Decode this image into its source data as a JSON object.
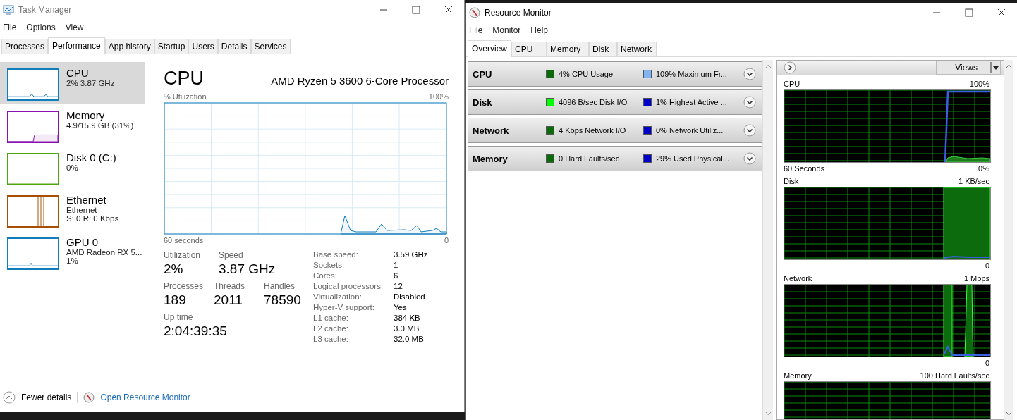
{
  "task_manager": {
    "title": "Task Manager",
    "menu": [
      "File",
      "Options",
      "View"
    ],
    "tabs": [
      {
        "label": "Processes",
        "selected": false
      },
      {
        "label": "Performance",
        "selected": true
      },
      {
        "label": "App history",
        "selected": false
      },
      {
        "label": "Startup",
        "selected": false
      },
      {
        "label": "Users",
        "selected": false
      },
      {
        "label": "Details",
        "selected": false
      },
      {
        "label": "Services",
        "selected": false
      }
    ],
    "sidebar": [
      {
        "name": "CPU",
        "lines": [
          "2% 3.87 GHz"
        ],
        "color": "#117dbb",
        "selected": true
      },
      {
        "name": "Memory",
        "lines": [
          "4.9/15.9 GB (31%)"
        ],
        "color": "#8b12ae",
        "selected": false
      },
      {
        "name": "Disk 0 (C:)",
        "lines": [
          "0%"
        ],
        "color": "#4da60c",
        "selected": false
      },
      {
        "name": "Ethernet",
        "lines": [
          "Ethernet",
          "S: 0 R: 0 Kbps"
        ],
        "color": "#a74f01",
        "selected": false
      },
      {
        "name": "GPU 0",
        "lines": [
          "AMD Radeon RX 5...",
          "1%"
        ],
        "color": "#117dbb",
        "selected": false
      }
    ],
    "detail": {
      "title": "CPU",
      "processor": "AMD Ryzen 5 3600 6-Core Processor",
      "chart_label": "% Utilization",
      "chart_max": "100%",
      "chart_span": "60 seconds",
      "chart_min": "0",
      "stat_rows": [
        {
          "items": [
            {
              "label": "Utilization",
              "value": "2%"
            },
            {
              "label": "Speed",
              "value": "3.87 GHz"
            }
          ]
        },
        {
          "items": [
            {
              "label": "Processes",
              "value": "189"
            },
            {
              "label": "Threads",
              "value": "2011"
            },
            {
              "label": "Handles",
              "value": "78590"
            }
          ]
        },
        {
          "items": [
            {
              "label": "Up time",
              "value": "2:04:39:35"
            }
          ]
        }
      ],
      "specs": [
        {
          "label": "Base speed:",
          "value": "3.59 GHz"
        },
        {
          "label": "Sockets:",
          "value": "1"
        },
        {
          "label": "Cores:",
          "value": "6"
        },
        {
          "label": "Logical processors:",
          "value": "12"
        },
        {
          "label": "Virtualization:",
          "value": "Disabled"
        },
        {
          "label": "Hyper-V support:",
          "value": "Yes"
        },
        {
          "label": "L1 cache:",
          "value": "384 KB"
        },
        {
          "label": "L2 cache:",
          "value": "3.0 MB"
        },
        {
          "label": "L3 cache:",
          "value": "32.0 MB"
        }
      ]
    },
    "footer": {
      "fewer_details": "Fewer details",
      "link": "Open Resource Monitor"
    }
  },
  "resource_monitor": {
    "title": "Resource Monitor",
    "menu": [
      "File",
      "Monitor",
      "Help"
    ],
    "tabs": [
      {
        "label": "Overview",
        "selected": true
      },
      {
        "label": "CPU",
        "selected": false
      },
      {
        "label": "Memory",
        "selected": false
      },
      {
        "label": "Disk",
        "selected": false
      },
      {
        "label": "Network",
        "selected": false
      }
    ],
    "sections": [
      {
        "name": "CPU",
        "metrics": [
          {
            "color": "#0b6b0b",
            "text": "4% CPU Usage"
          },
          {
            "color": "#7fb4f0",
            "text": "109% Maximum Fr..."
          }
        ]
      },
      {
        "name": "Disk",
        "metrics": [
          {
            "color": "#00ff00",
            "text": "4096 B/sec Disk I/O"
          },
          {
            "color": "#0000c8",
            "text": "1% Highest Active ..."
          }
        ]
      },
      {
        "name": "Network",
        "metrics": [
          {
            "color": "#0b6b0b",
            "text": "4 Kbps Network I/O"
          },
          {
            "color": "#0000c8",
            "text": "0% Network Utiliz..."
          }
        ]
      },
      {
        "name": "Memory",
        "metrics": [
          {
            "color": "#0b6b0b",
            "text": "0 Hard Faults/sec"
          },
          {
            "color": "#0000c8",
            "text": "29% Used Physical..."
          }
        ]
      }
    ],
    "views": "Views",
    "graphs": [
      {
        "title": "CPU",
        "max": "100%",
        "span": "60 Seconds",
        "min": "0%"
      },
      {
        "title": "Disk",
        "max": "1 KB/sec",
        "min": "0"
      },
      {
        "title": "Network",
        "max": "1 Mbps",
        "min": "0"
      },
      {
        "title": "Memory",
        "max": "100 Hard Faults/sec"
      }
    ]
  }
}
